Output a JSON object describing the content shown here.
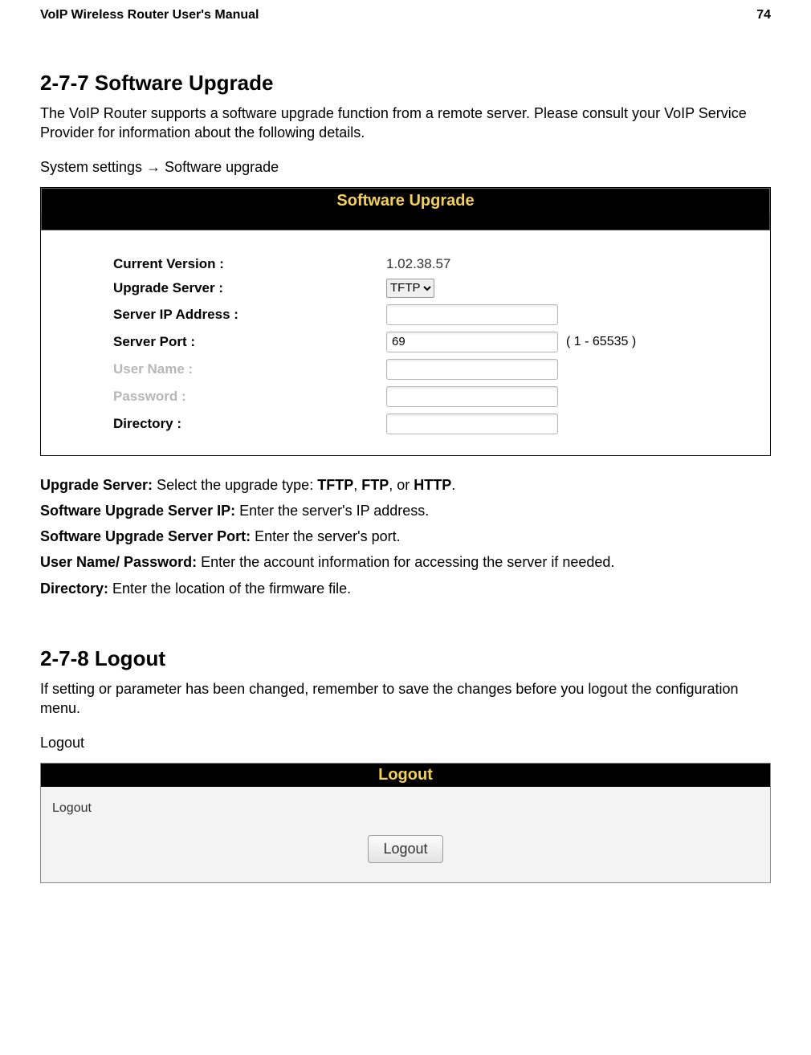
{
  "header": {
    "doc_title": "VoIP Wireless Router User's Manual",
    "page_no": "74"
  },
  "s277": {
    "heading": "2-7-7 Software Upgrade",
    "intro": "The VoIP Router supports a software upgrade function from a remote server. Please consult your VoIP Service Provider for information about the following details.",
    "path": "System settings  →  Software upgrade",
    "panel_title": "Software Upgrade",
    "form": {
      "current_version_label": "Current Version :",
      "current_version_value": "1.02.38.57",
      "upgrade_server_label": "Upgrade Server :",
      "upgrade_server_value": "TFTP",
      "server_ip_label": "Server IP Address :",
      "server_ip_value": "",
      "server_port_label": "Server Port :",
      "server_port_value": "69",
      "server_port_hint": "( 1 - 65535 )",
      "user_name_label": "User Name :",
      "user_name_value": "",
      "password_label": "Password :",
      "password_value": "",
      "directory_label": "Directory :",
      "directory_value": ""
    },
    "defs": {
      "upgrade_server": {
        "term": "Upgrade Server: ",
        "text": "Select the upgrade type: ",
        "v1": "TFTP",
        "sep": ", ",
        "v2": "FTP",
        "sep2": ", or ",
        "v3": "HTTP",
        "tail": "."
      },
      "server_ip": {
        "term": "Software Upgrade Server IP: ",
        "text": "Enter the server's IP address."
      },
      "server_port": {
        "term": "Software Upgrade Server Port: ",
        "text": "Enter the server's port."
      },
      "user_pass": {
        "term": "User Name/ Password: ",
        "text": "Enter the account information for accessing the server if needed."
      },
      "directory": {
        "term": "Directory: ",
        "text": "Enter the location of the firmware file."
      }
    }
  },
  "s278": {
    "heading": "2-7-8 Logout",
    "intro": "If setting or parameter has been changed, remember to save the changes before you logout the configuration menu.",
    "path": "Logout",
    "panel_title": "Logout",
    "body_label": "Logout",
    "button": "Logout"
  }
}
